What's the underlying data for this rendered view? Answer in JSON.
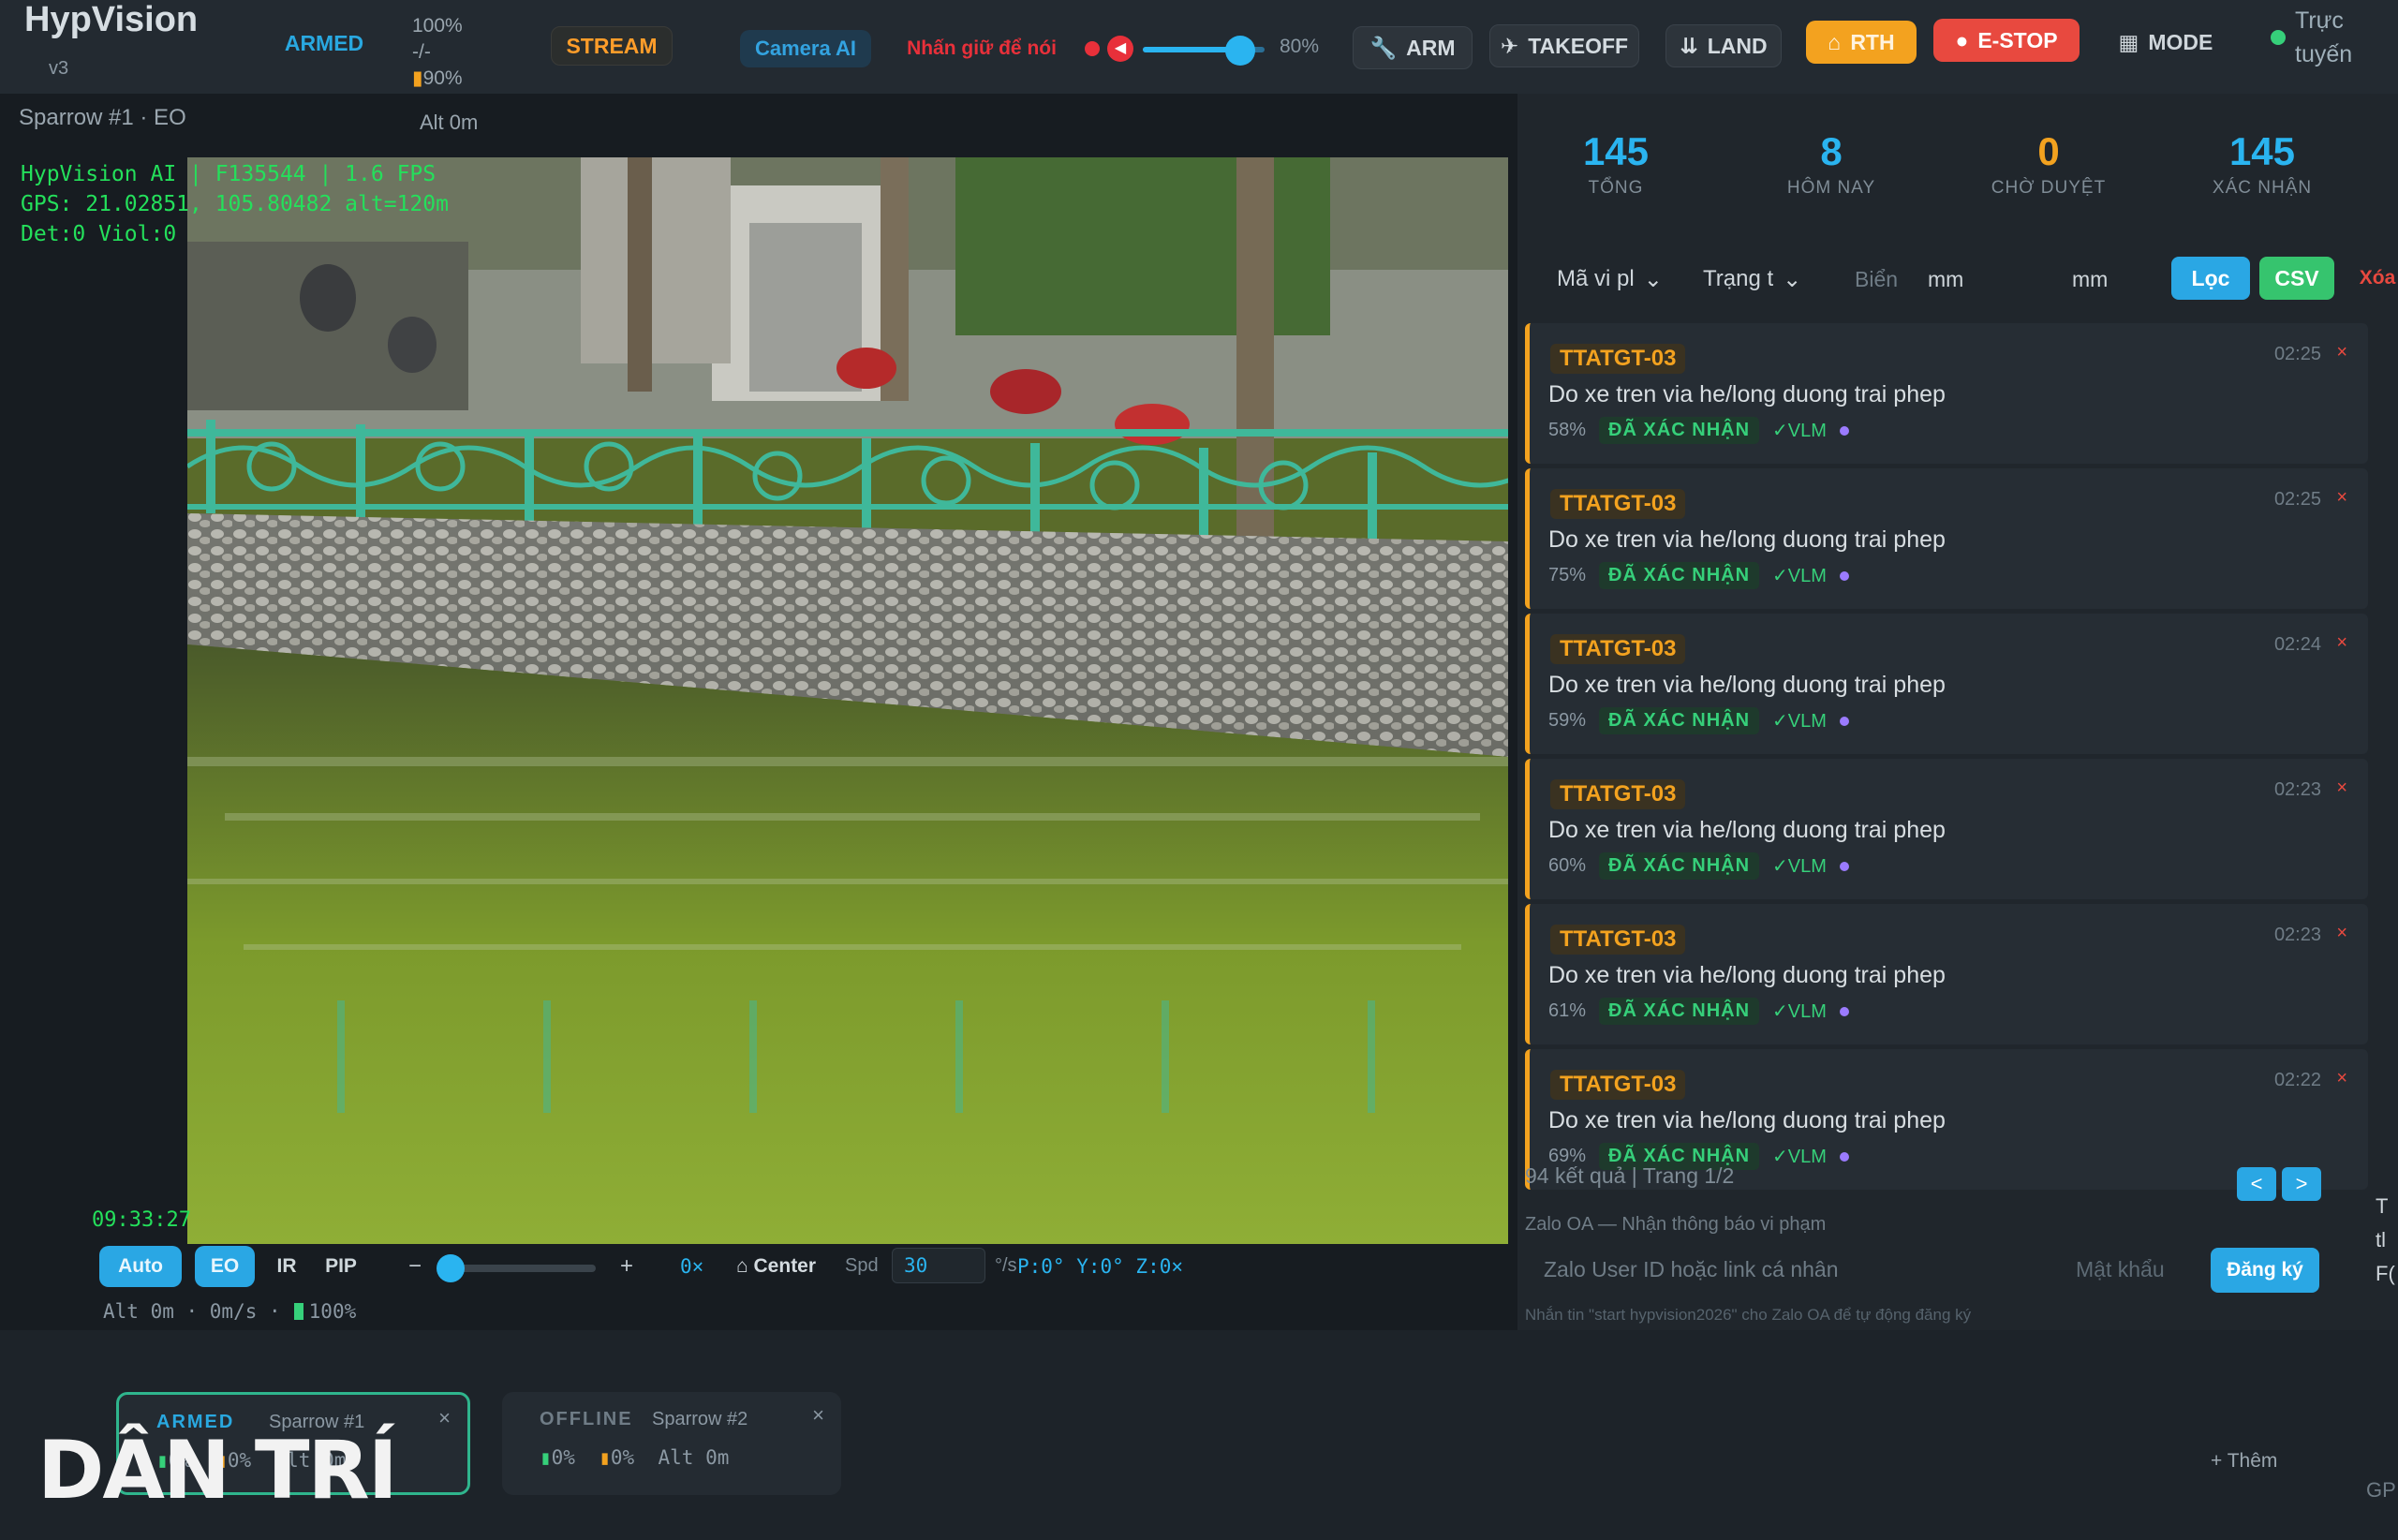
{
  "header": {
    "app_name": "HypVision",
    "version": "v3",
    "armed_label": "ARMED",
    "battery": "100%",
    "signal_dash": "-/-",
    "signal_pct": "90%",
    "stream_label": "STREAM",
    "camera_ai_label": "Camera AI",
    "push_to_talk_label": "Nhấn giữ để nói",
    "volume_pct": "80%",
    "volume_value": 0.8,
    "arm_label": "ARM",
    "takeoff_label": "TAKEOFF",
    "land_label": "LAND",
    "rth_label": "RTH",
    "estop_label": "E-STOP",
    "mode_label": "MODE",
    "online_label": "Trực tuyến"
  },
  "video": {
    "drone_label": "Sparrow #1 · EO",
    "alt_label": "Alt 0m",
    "overlay_line1": "HypVision AI | F135544 | 1.6 FPS",
    "overlay_line2": "GPS: 21.02851, 105.80482 alt=120m",
    "overlay_line3": "Det:0 Viol:0",
    "time": "09:33:27",
    "controls": {
      "auto": "Auto",
      "eo": "EO",
      "ir": "IR",
      "pip": "PIP",
      "minus": "−",
      "plus": "+",
      "zoom": "0×",
      "center": "⌂ Center",
      "spd_label": "Spd",
      "spd_value": "30",
      "spd_unit": "°/s",
      "gimbal": "P:0° Y:0° Z:0×"
    },
    "status_line_prefix": "Alt 0m · 0m/s ·",
    "status_battery": "100%"
  },
  "stats": [
    {
      "value": "145",
      "label": "TỔNG",
      "color": "#2ab4f0"
    },
    {
      "value": "8",
      "label": "HÔM NAY",
      "color": "#2ab4f0"
    },
    {
      "value": "0",
      "label": "CHỜ DUYỆT",
      "color": "#f3a21f"
    },
    {
      "value": "145",
      "label": "XÁC NHẬN",
      "color": "#2ab4f0"
    }
  ],
  "filters": {
    "code_select": "Mã vi pl",
    "status_select": "Trạng t",
    "plate_placeholder": "Biển",
    "date_from": "mm",
    "date_to": "mm",
    "filter_btn": "Lọc",
    "csv_btn": "CSV",
    "delete_btn": "Xóa"
  },
  "violations": [
    {
      "code": "TTATGT-03",
      "desc": "Do xe tren via he/long duong trai phep",
      "conf": "58%",
      "status": "ĐÃ XÁC NHẬN",
      "vlm": "✓VLM",
      "time": "02:25"
    },
    {
      "code": "TTATGT-03",
      "desc": "Do xe tren via he/long duong trai phep",
      "conf": "75%",
      "status": "ĐÃ XÁC NHẬN",
      "vlm": "✓VLM",
      "time": "02:25"
    },
    {
      "code": "TTATGT-03",
      "desc": "Do xe tren via he/long duong trai phep",
      "conf": "59%",
      "status": "ĐÃ XÁC NHẬN",
      "vlm": "✓VLM",
      "time": "02:24"
    },
    {
      "code": "TTATGT-03",
      "desc": "Do xe tren via he/long duong trai phep",
      "conf": "60%",
      "status": "ĐÃ XÁC NHẬN",
      "vlm": "✓VLM",
      "time": "02:23"
    },
    {
      "code": "TTATGT-03",
      "desc": "Do xe tren via he/long duong trai phep",
      "conf": "61%",
      "status": "ĐÃ XÁC NHẬN",
      "vlm": "✓VLM",
      "time": "02:23"
    },
    {
      "code": "TTATGT-03",
      "desc": "Do xe tren via he/long duong trai phep",
      "conf": "69%",
      "status": "ĐÃ XÁC NHẬN",
      "vlm": "✓VLM",
      "time": "02:22"
    }
  ],
  "pagination": {
    "summary": "94 kết quả | Trang 1/2",
    "prev": "<",
    "next": ">"
  },
  "zalo": {
    "title": "Zalo OA — Nhận thông báo vi phạm",
    "user_placeholder": "Zalo User ID hoặc link cá nhân",
    "password_placeholder": "Mật khẩu",
    "register_btn": "Đăng ký",
    "hint": "Nhắn tin \"start hypvision2026\" cho Zalo OA để tự động đăng ký"
  },
  "drones": [
    {
      "status": "ARMED",
      "name": "Sparrow #1",
      "battery": "0%",
      "signal": "0%",
      "alt": "Alt 0m",
      "status_color": "#29a8e0",
      "close": "×"
    },
    {
      "status": "OFFLINE",
      "name": "Sparrow #2",
      "battery": "0%",
      "signal": "0%",
      "alt": "Alt 0m",
      "status_color": "#6f7c86",
      "close": "×"
    }
  ],
  "add_drone": "+ Thêm",
  "edge_text": "GP",
  "edge_right": [
    "T",
    "tl",
    "F("
  ],
  "watermark": "DÂN TRÍ",
  "colors": {
    "accent": "#2ab4f0",
    "warning": "#f3a21f",
    "danger": "#e8493f",
    "success": "#36d07a",
    "osd_green": "#24e05b"
  }
}
